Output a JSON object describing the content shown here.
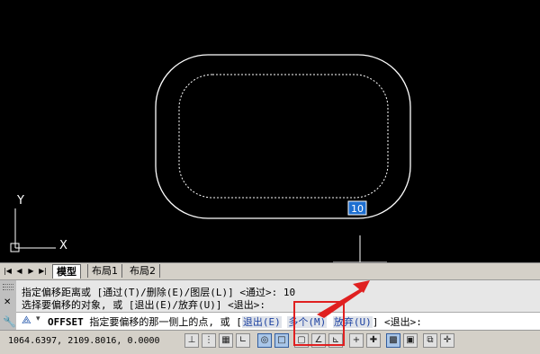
{
  "canvas": {
    "dim_value": "10",
    "axis_y_label": "Y",
    "axis_x_label": "X"
  },
  "tabs": {
    "model": "模型",
    "layout1": "布局1",
    "layout2": "布局2"
  },
  "command": {
    "history_line1": "指定偏移距离或 [通过(T)/删除(E)/图层(L)] <通过>: 10",
    "history_line2": "选择要偏移的对象, 或 [退出(E)/放弃(U)] <退出>:",
    "prompt_command": "OFFSET",
    "prompt_text": "指定要偏移的那一侧上的点, 或 [",
    "opt_exit": "退出(E)",
    "opt_multiple": "多个(M)",
    "opt_undo": "放弃(U)",
    "prompt_end": "] <退出>:"
  },
  "status": {
    "coordinates": "1064.6397, 2109.8016, 0.0000"
  },
  "colors": {
    "highlight_box": "#e02020",
    "arrow": "#e02020",
    "canvas_bg": "#000000",
    "dim_box": "#1e6fd0"
  }
}
